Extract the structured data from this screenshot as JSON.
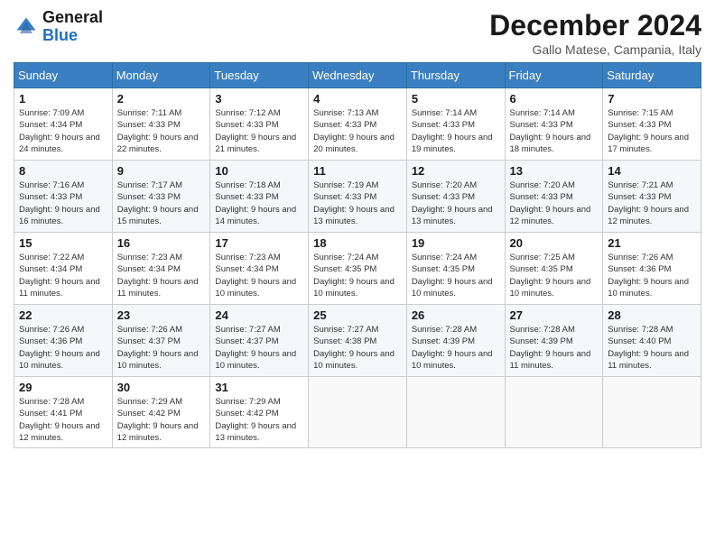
{
  "header": {
    "logo_general": "General",
    "logo_blue": "Blue",
    "title": "December 2024",
    "location": "Gallo Matese, Campania, Italy"
  },
  "weekdays": [
    "Sunday",
    "Monday",
    "Tuesday",
    "Wednesday",
    "Thursday",
    "Friday",
    "Saturday"
  ],
  "weeks": [
    [
      {
        "day": "1",
        "sunrise": "Sunrise: 7:09 AM",
        "sunset": "Sunset: 4:34 PM",
        "daylight": "Daylight: 9 hours and 24 minutes."
      },
      {
        "day": "2",
        "sunrise": "Sunrise: 7:11 AM",
        "sunset": "Sunset: 4:33 PM",
        "daylight": "Daylight: 9 hours and 22 minutes."
      },
      {
        "day": "3",
        "sunrise": "Sunrise: 7:12 AM",
        "sunset": "Sunset: 4:33 PM",
        "daylight": "Daylight: 9 hours and 21 minutes."
      },
      {
        "day": "4",
        "sunrise": "Sunrise: 7:13 AM",
        "sunset": "Sunset: 4:33 PM",
        "daylight": "Daylight: 9 hours and 20 minutes."
      },
      {
        "day": "5",
        "sunrise": "Sunrise: 7:14 AM",
        "sunset": "Sunset: 4:33 PM",
        "daylight": "Daylight: 9 hours and 19 minutes."
      },
      {
        "day": "6",
        "sunrise": "Sunrise: 7:14 AM",
        "sunset": "Sunset: 4:33 PM",
        "daylight": "Daylight: 9 hours and 18 minutes."
      },
      {
        "day": "7",
        "sunrise": "Sunrise: 7:15 AM",
        "sunset": "Sunset: 4:33 PM",
        "daylight": "Daylight: 9 hours and 17 minutes."
      }
    ],
    [
      {
        "day": "8",
        "sunrise": "Sunrise: 7:16 AM",
        "sunset": "Sunset: 4:33 PM",
        "daylight": "Daylight: 9 hours and 16 minutes."
      },
      {
        "day": "9",
        "sunrise": "Sunrise: 7:17 AM",
        "sunset": "Sunset: 4:33 PM",
        "daylight": "Daylight: 9 hours and 15 minutes."
      },
      {
        "day": "10",
        "sunrise": "Sunrise: 7:18 AM",
        "sunset": "Sunset: 4:33 PM",
        "daylight": "Daylight: 9 hours and 14 minutes."
      },
      {
        "day": "11",
        "sunrise": "Sunrise: 7:19 AM",
        "sunset": "Sunset: 4:33 PM",
        "daylight": "Daylight: 9 hours and 13 minutes."
      },
      {
        "day": "12",
        "sunrise": "Sunrise: 7:20 AM",
        "sunset": "Sunset: 4:33 PM",
        "daylight": "Daylight: 9 hours and 13 minutes."
      },
      {
        "day": "13",
        "sunrise": "Sunrise: 7:20 AM",
        "sunset": "Sunset: 4:33 PM",
        "daylight": "Daylight: 9 hours and 12 minutes."
      },
      {
        "day": "14",
        "sunrise": "Sunrise: 7:21 AM",
        "sunset": "Sunset: 4:33 PM",
        "daylight": "Daylight: 9 hours and 12 minutes."
      }
    ],
    [
      {
        "day": "15",
        "sunrise": "Sunrise: 7:22 AM",
        "sunset": "Sunset: 4:34 PM",
        "daylight": "Daylight: 9 hours and 11 minutes."
      },
      {
        "day": "16",
        "sunrise": "Sunrise: 7:23 AM",
        "sunset": "Sunset: 4:34 PM",
        "daylight": "Daylight: 9 hours and 11 minutes."
      },
      {
        "day": "17",
        "sunrise": "Sunrise: 7:23 AM",
        "sunset": "Sunset: 4:34 PM",
        "daylight": "Daylight: 9 hours and 10 minutes."
      },
      {
        "day": "18",
        "sunrise": "Sunrise: 7:24 AM",
        "sunset": "Sunset: 4:35 PM",
        "daylight": "Daylight: 9 hours and 10 minutes."
      },
      {
        "day": "19",
        "sunrise": "Sunrise: 7:24 AM",
        "sunset": "Sunset: 4:35 PM",
        "daylight": "Daylight: 9 hours and 10 minutes."
      },
      {
        "day": "20",
        "sunrise": "Sunrise: 7:25 AM",
        "sunset": "Sunset: 4:35 PM",
        "daylight": "Daylight: 9 hours and 10 minutes."
      },
      {
        "day": "21",
        "sunrise": "Sunrise: 7:26 AM",
        "sunset": "Sunset: 4:36 PM",
        "daylight": "Daylight: 9 hours and 10 minutes."
      }
    ],
    [
      {
        "day": "22",
        "sunrise": "Sunrise: 7:26 AM",
        "sunset": "Sunset: 4:36 PM",
        "daylight": "Daylight: 9 hours and 10 minutes."
      },
      {
        "day": "23",
        "sunrise": "Sunrise: 7:26 AM",
        "sunset": "Sunset: 4:37 PM",
        "daylight": "Daylight: 9 hours and 10 minutes."
      },
      {
        "day": "24",
        "sunrise": "Sunrise: 7:27 AM",
        "sunset": "Sunset: 4:37 PM",
        "daylight": "Daylight: 9 hours and 10 minutes."
      },
      {
        "day": "25",
        "sunrise": "Sunrise: 7:27 AM",
        "sunset": "Sunset: 4:38 PM",
        "daylight": "Daylight: 9 hours and 10 minutes."
      },
      {
        "day": "26",
        "sunrise": "Sunrise: 7:28 AM",
        "sunset": "Sunset: 4:39 PM",
        "daylight": "Daylight: 9 hours and 10 minutes."
      },
      {
        "day": "27",
        "sunrise": "Sunrise: 7:28 AM",
        "sunset": "Sunset: 4:39 PM",
        "daylight": "Daylight: 9 hours and 11 minutes."
      },
      {
        "day": "28",
        "sunrise": "Sunrise: 7:28 AM",
        "sunset": "Sunset: 4:40 PM",
        "daylight": "Daylight: 9 hours and 11 minutes."
      }
    ],
    [
      {
        "day": "29",
        "sunrise": "Sunrise: 7:28 AM",
        "sunset": "Sunset: 4:41 PM",
        "daylight": "Daylight: 9 hours and 12 minutes."
      },
      {
        "day": "30",
        "sunrise": "Sunrise: 7:29 AM",
        "sunset": "Sunset: 4:42 PM",
        "daylight": "Daylight: 9 hours and 12 minutes."
      },
      {
        "day": "31",
        "sunrise": "Sunrise: 7:29 AM",
        "sunset": "Sunset: 4:42 PM",
        "daylight": "Daylight: 9 hours and 13 minutes."
      },
      null,
      null,
      null,
      null
    ]
  ]
}
